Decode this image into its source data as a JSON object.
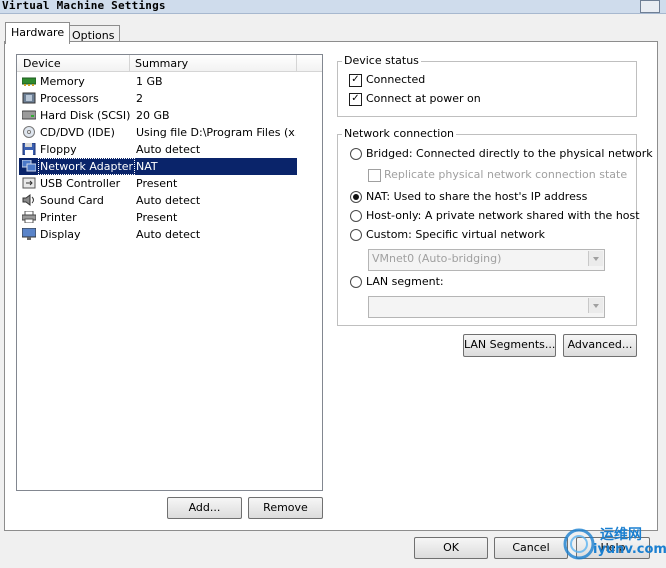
{
  "window": {
    "title": "Virtual Machine Settings"
  },
  "tabs": [
    {
      "label": "Hardware",
      "active": true
    },
    {
      "label": "Options",
      "active": false
    }
  ],
  "device_list": {
    "columns": [
      "Device",
      "Summary"
    ],
    "rows": [
      {
        "device": "Memory",
        "summary": "1 GB",
        "icon": "memory-icon"
      },
      {
        "device": "Processors",
        "summary": "2",
        "icon": "processor-icon"
      },
      {
        "device": "Hard Disk (SCSI)",
        "summary": "20 GB",
        "icon": "hard-disk-icon"
      },
      {
        "device": "CD/DVD (IDE)",
        "summary": "Using file D:\\Program Files (x...",
        "icon": "cd-dvd-icon"
      },
      {
        "device": "Floppy",
        "summary": "Auto detect",
        "icon": "floppy-icon"
      },
      {
        "device": "Network Adapter",
        "summary": "NAT",
        "icon": "network-adapter-icon",
        "selected": true
      },
      {
        "device": "USB Controller",
        "summary": "Present",
        "icon": "usb-icon"
      },
      {
        "device": "Sound Card",
        "summary": "Auto detect",
        "icon": "sound-card-icon"
      },
      {
        "device": "Printer",
        "summary": "Present",
        "icon": "printer-icon"
      },
      {
        "device": "Display",
        "summary": "Auto detect",
        "icon": "display-icon"
      }
    ],
    "add_label": "Add...",
    "remove_label": "Remove"
  },
  "device_status": {
    "title": "Device status",
    "connected": {
      "label": "Connected",
      "checked": true
    },
    "connect_at_power_on": {
      "label": "Connect at power on",
      "checked": true
    }
  },
  "network_connection": {
    "title": "Network connection",
    "bridged": {
      "label": "Bridged: Connected directly to the physical network",
      "selected": false
    },
    "replicate": {
      "label": "Replicate physical network connection state",
      "checked": false,
      "disabled": true
    },
    "nat": {
      "label": "NAT: Used to share the host's IP address",
      "selected": true
    },
    "host_only": {
      "label": "Host-only: A private network shared with the host",
      "selected": false
    },
    "custom": {
      "label": "Custom: Specific virtual network",
      "selected": false
    },
    "custom_select": {
      "value": "VMnet0 (Auto-bridging)",
      "disabled": true
    },
    "lan_segment": {
      "label": "LAN segment:",
      "selected": false
    },
    "lan_select": {
      "value": "",
      "disabled": true
    }
  },
  "buttons": {
    "lan_segments": "LAN Segments...",
    "advanced": "Advanced...",
    "ok": "OK",
    "cancel": "Cancel",
    "help": "Help"
  },
  "watermark": {
    "cn": "运维网",
    "site": "iyunv.com"
  },
  "colors": {
    "selection": "#0a246a",
    "titlebar": "#cfdcec",
    "watermark": "#1a7fd0"
  }
}
